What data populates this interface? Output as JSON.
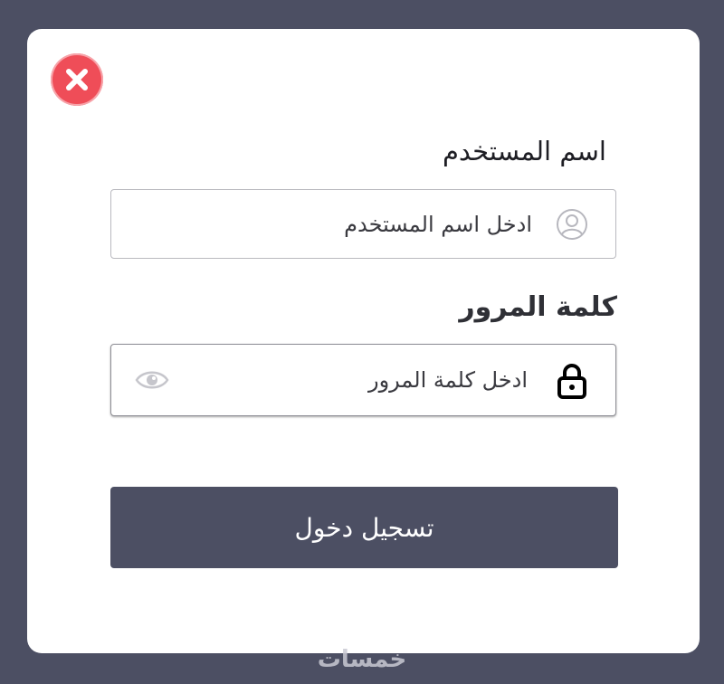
{
  "form": {
    "username_label": "اسم المستخدم",
    "username_placeholder": "ادخل اسم المستخدم",
    "password_label": "كلمة المرور",
    "password_placeholder": "ادخل كلمة المرور",
    "login_label": "تسجيل دخول"
  },
  "icons": {
    "close": "close-icon",
    "user": "user-icon",
    "lock": "lock-icon",
    "eye": "eye-icon"
  },
  "colors": {
    "background": "#4c4f63",
    "card": "#ffffff",
    "close_button": "#ef4d58",
    "login_button": "#4c4f63"
  },
  "watermark": "خمسات"
}
